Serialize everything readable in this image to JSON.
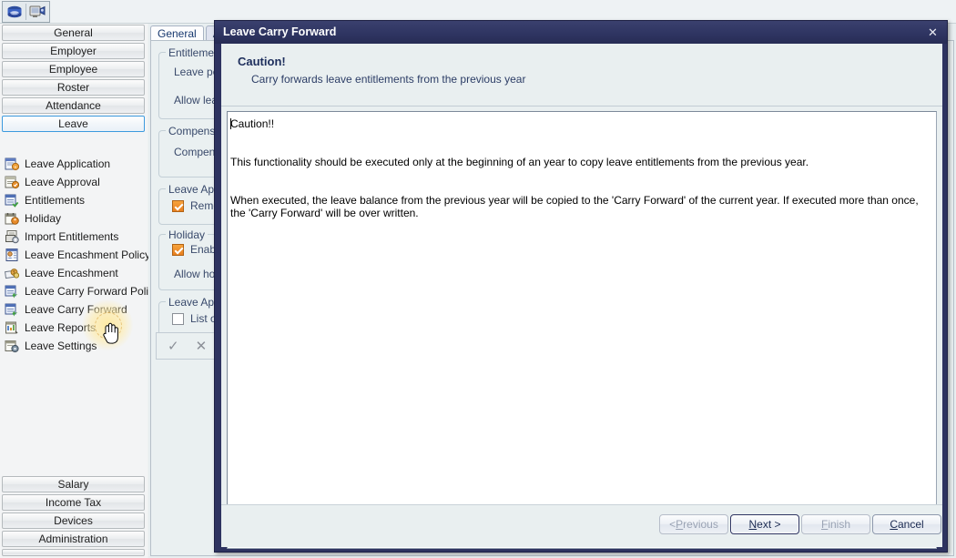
{
  "toolbar": {
    "buttons": [
      {
        "name": "book-database-icon",
        "title": "Data"
      },
      {
        "name": "camera-monitor-icon",
        "title": "Capture"
      }
    ]
  },
  "sidebar": {
    "top_buttons": [
      {
        "label": "General",
        "selected": false
      },
      {
        "label": "Employer",
        "selected": false
      },
      {
        "label": "Employee",
        "selected": false
      },
      {
        "label": "Roster",
        "selected": false
      },
      {
        "label": "Attendance",
        "selected": false
      },
      {
        "label": "Leave",
        "selected": true
      }
    ],
    "items": [
      {
        "label": "Leave Application",
        "icon": "leave-application-icon"
      },
      {
        "label": "Leave Approval",
        "icon": "leave-approval-icon"
      },
      {
        "label": "Entitlements",
        "icon": "entitlements-icon"
      },
      {
        "label": "Holiday",
        "icon": "holiday-icon"
      },
      {
        "label": "Import Entitlements",
        "icon": "import-entitlements-icon"
      },
      {
        "label": "Leave Encashment Policy",
        "icon": "leave-encashment-policy-icon"
      },
      {
        "label": "Leave Encashment",
        "icon": "leave-encashment-icon"
      },
      {
        "label": "Leave Carry Forward Policy",
        "icon": "leave-carry-forward-policy-icon"
      },
      {
        "label": "Leave Carry Forward",
        "icon": "leave-carry-forward-icon"
      },
      {
        "label": "Leave Reports",
        "icon": "leave-reports-icon"
      },
      {
        "label": "Leave Settings",
        "icon": "leave-settings-icon"
      }
    ],
    "bottom_buttons": [
      {
        "label": "Salary"
      },
      {
        "label": "Income Tax"
      },
      {
        "label": "Devices"
      },
      {
        "label": "Administration"
      }
    ]
  },
  "background_form": {
    "tabs": [
      {
        "label": "General",
        "active": true
      },
      {
        "label": "Ale",
        "active": false
      }
    ],
    "groups": [
      {
        "title": "Entitlement",
        "fields": [
          "Leave peri",
          "Allow leave"
        ]
      },
      {
        "title": "Compensat",
        "fields": [
          "Compensa"
        ]
      },
      {
        "title": "Leave Appr",
        "checkbox": {
          "label": "Remov",
          "checked": true
        }
      },
      {
        "title": "Holiday",
        "checkbox": {
          "label": "Enable",
          "checked": true
        },
        "fields": [
          "Allow holid"
        ]
      },
      {
        "title": "Leave Appl",
        "checkbox": {
          "label": "List on",
          "checked": false
        }
      }
    ],
    "action_bar": {
      "ok_icon": "checkmark-icon",
      "cancel_icon": "cross-icon"
    }
  },
  "dialog": {
    "title": "Leave Carry Forward",
    "close_label": "✕",
    "banner": {
      "heading": "Caution!",
      "subheading": "Carry forwards leave entitlements from the previous year"
    },
    "body": {
      "line1": "Caution!!",
      "line2": "This functionality should be executed only at the beginning of an year to copy leave entitlements from the previous year.",
      "line3": "When executed, the leave balance from the previous year will be copied to the 'Carry Forward' of the current year. If executed more than once, the 'Carry Forward' will be over written."
    },
    "buttons": {
      "previous": {
        "pre": "< ",
        "accel": "P",
        "post": "revious",
        "disabled": true
      },
      "next": {
        "pre": "",
        "accel": "N",
        "post": "ext >",
        "disabled": false,
        "default": true
      },
      "finish": {
        "pre": "",
        "accel": "F",
        "post": "inish",
        "disabled": true
      },
      "cancel": {
        "pre": "",
        "accel": "C",
        "post": "ancel",
        "disabled": false
      }
    }
  },
  "colors": {
    "dialog_chrome": "#2e3360",
    "dialog_face": "#e9eff0",
    "accent_blue": "#3c9ade",
    "checkbox_on": "#e87f1e",
    "cursor_halo": "#ffe896"
  }
}
